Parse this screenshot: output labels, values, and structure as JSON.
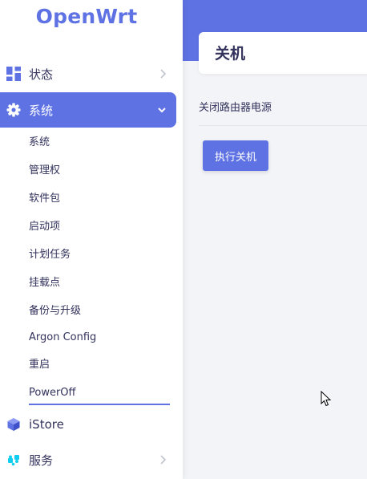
{
  "brand": {
    "logo_text": "OpenWrt",
    "accent_color": "#5e72e4"
  },
  "sidebar": {
    "items": [
      {
        "label": "状态",
        "icon": "dashboard-icon",
        "expanded": false
      },
      {
        "label": "系统",
        "icon": "gear-icon",
        "expanded": true,
        "active": true
      },
      {
        "label": "iStore",
        "icon": "cube-icon"
      },
      {
        "label": "服务",
        "icon": "puzzle-icon",
        "expanded": false
      }
    ],
    "submenu": [
      "系统",
      "管理权",
      "软件包",
      "启动项",
      "计划任务",
      "挂载点",
      "备份与升级",
      "Argon Config",
      "重启",
      "PowerOff"
    ],
    "current_submenu": "PowerOff"
  },
  "main": {
    "title": "关机",
    "description": "关闭路由器电源",
    "action_button": "执行关机"
  }
}
